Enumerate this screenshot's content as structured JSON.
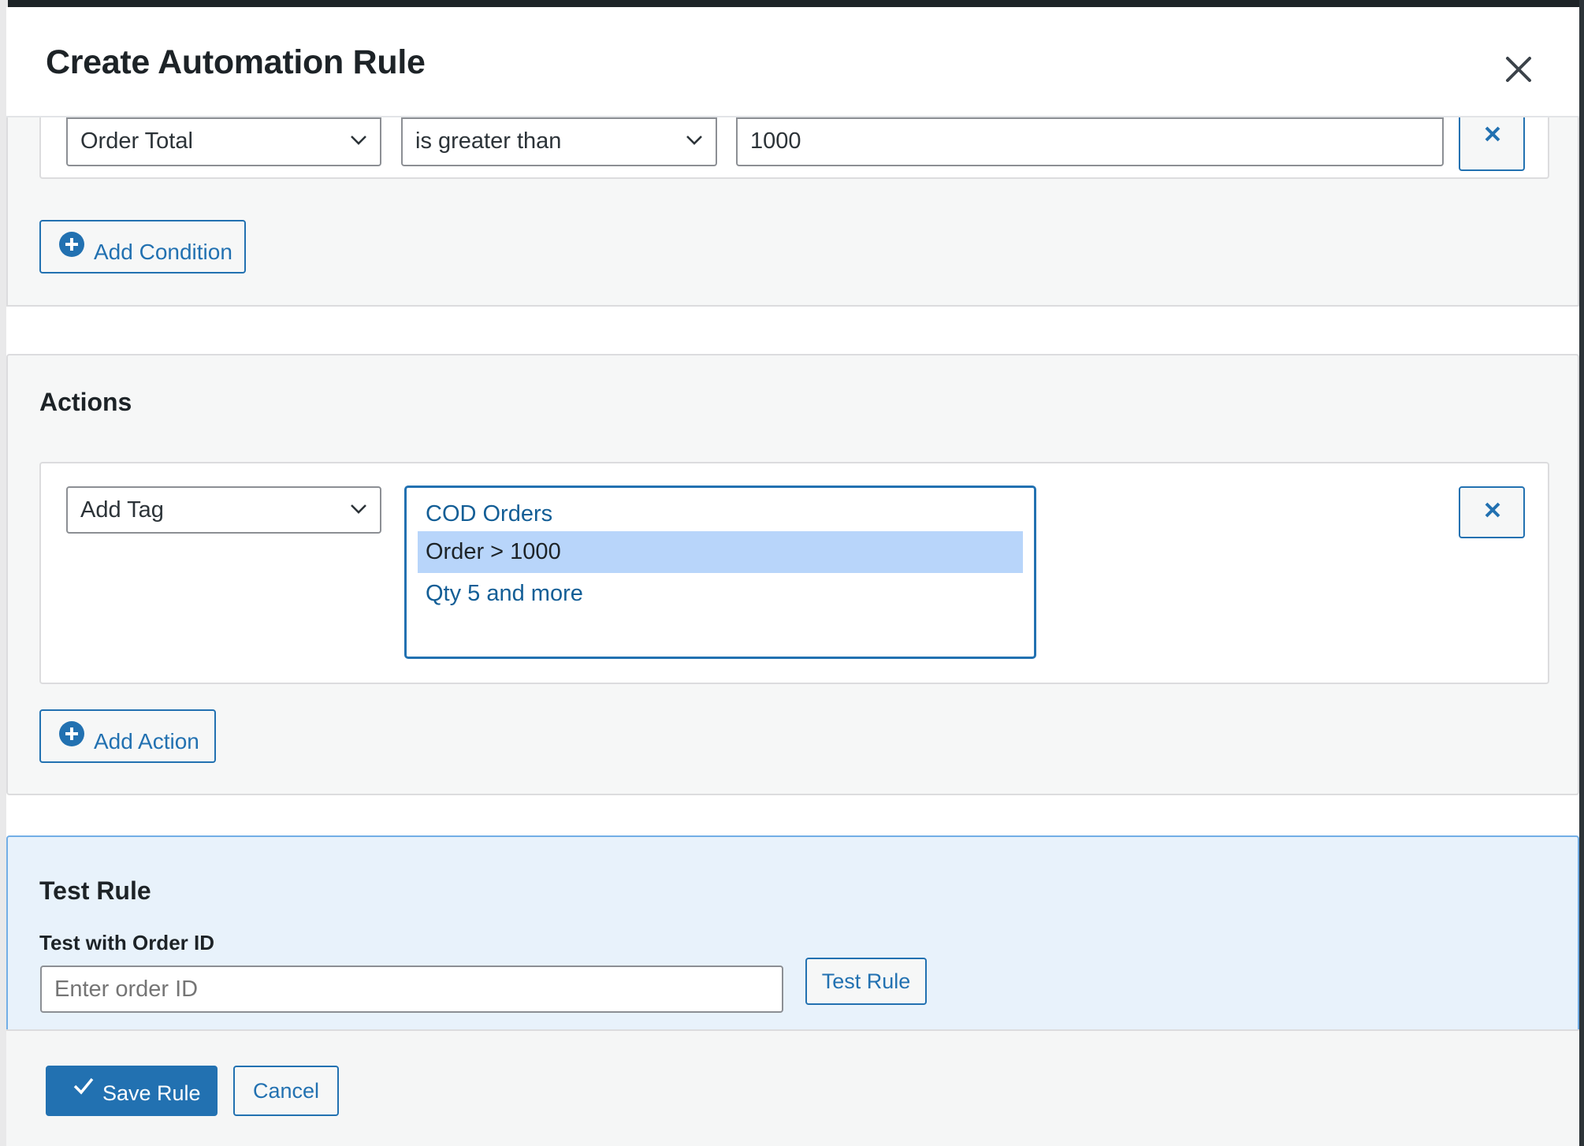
{
  "modal": {
    "title": "Create Automation Rule"
  },
  "conditions": {
    "field_value": "Order Total",
    "operator_value": "is greater than",
    "amount_value": "1000",
    "add_label": "Add Condition"
  },
  "actions": {
    "heading": "Actions",
    "action_value": "Add Tag",
    "tag_options": [
      {
        "label": "COD Orders",
        "selected": false
      },
      {
        "label": "Order > 1000",
        "selected": true
      },
      {
        "label": "Qty 5 and more",
        "selected": false
      }
    ],
    "add_label": "Add Action"
  },
  "test": {
    "heading": "Test Rule",
    "field_label": "Test with Order ID",
    "placeholder": "Enter order ID",
    "button_label": "Test Rule"
  },
  "footer": {
    "save_label": "Save Rule",
    "cancel_label": "Cancel"
  },
  "colors": {
    "accent": "#2271b1",
    "selected_option": "#b8d5fa",
    "test_panel_bg": "#e8f2fb"
  }
}
